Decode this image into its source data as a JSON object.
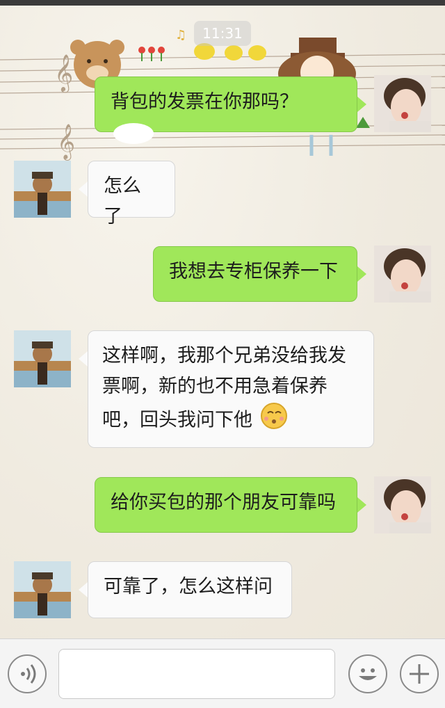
{
  "status": {
    "time": "11:31"
  },
  "colors": {
    "my_bubble": "#a0e75a",
    "their_bubble": "#fafafa",
    "bg": "#f3efe6"
  },
  "messages": [
    {
      "from": "me",
      "text": "背包的发票在你那吗？"
    },
    {
      "from": "them",
      "text": "怎么了"
    },
    {
      "from": "me",
      "text": "我想去专柜保养一下"
    },
    {
      "from": "them",
      "lines": [
        "这样啊，我那个兄弟没给我发",
        "票啊，新的也不用急着保养",
        "吧，回头我问下他"
      ],
      "emoji": "kissing-emoji"
    },
    {
      "from": "me",
      "text": "给你买包的那个朋友可靠吗"
    },
    {
      "from": "them",
      "text": "可靠了，怎么这样问"
    }
  ],
  "input": {
    "value": "",
    "icons": [
      "voice-icon",
      "emoji-icon",
      "plus-icon"
    ]
  }
}
